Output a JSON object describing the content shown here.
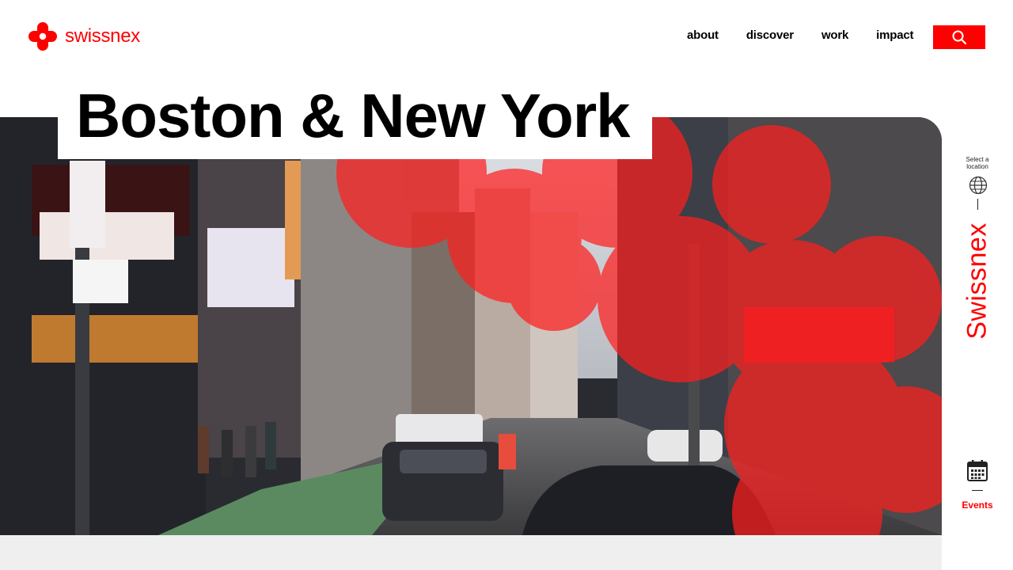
{
  "brand": {
    "name": "swissnex",
    "vertical_name": "Swissnex",
    "accent_color": "#ff0000"
  },
  "nav": {
    "items": [
      {
        "label": "about"
      },
      {
        "label": "discover"
      },
      {
        "label": "work"
      },
      {
        "label": "impact"
      }
    ],
    "search_icon": "search-icon"
  },
  "hero": {
    "title": "Boston & New York",
    "image": "city-street-photo"
  },
  "rail": {
    "select_location_line1": "Select a",
    "select_location_line2": "location",
    "globe_icon": "globe-icon",
    "events_icon": "calendar-icon",
    "events_label": "Events"
  }
}
